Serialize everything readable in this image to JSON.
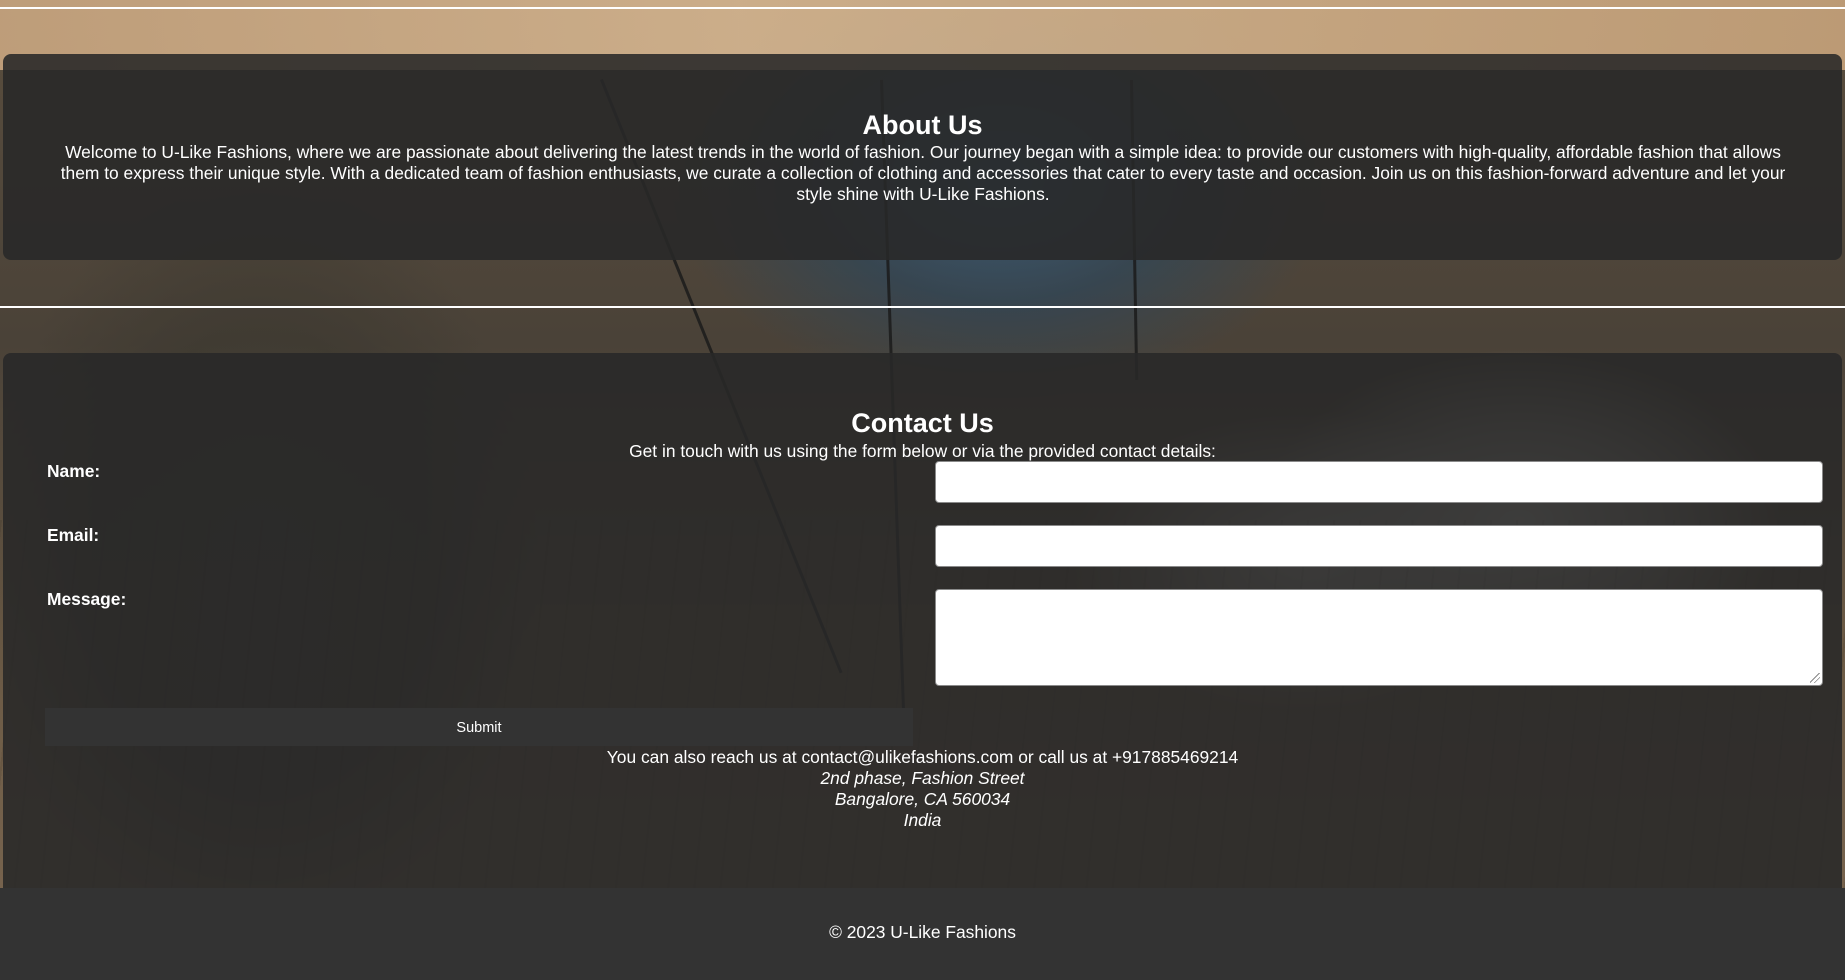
{
  "about": {
    "title": "About Us",
    "text": "Welcome to U-Like Fashions, where we are passionate about delivering the latest trends in the world of fashion. Our journey began with a simple idea: to provide our customers with high-quality, affordable fashion that allows them to express their unique style. With a dedicated team of fashion enthusiasts, we curate a collection of clothing and accessories that cater to every taste and occasion. Join us on this fashion-forward adventure and let your style shine with U-Like Fashions."
  },
  "contact": {
    "title": "Contact Us",
    "intro": "Get in touch with us using the form below or via the provided contact details:",
    "form": {
      "name_label": "Name:",
      "name_value": "",
      "email_label": "Email:",
      "email_value": "",
      "message_label": "Message:",
      "message_value": "",
      "submit_label": "Submit"
    },
    "reach": "You can also reach us at contact@ulikefashions.com or call us at +917885469214",
    "address": {
      "line1": "2nd phase, Fashion Street",
      "line2": "Bangalore, CA 560034",
      "line3": "India"
    }
  },
  "footer": {
    "copyright": "© 2023 U-Like Fashions"
  },
  "colors": {
    "panel_bg": "#282828",
    "footer_bg": "#333333",
    "text": "#ffffff",
    "field_bg": "#ffffff"
  }
}
